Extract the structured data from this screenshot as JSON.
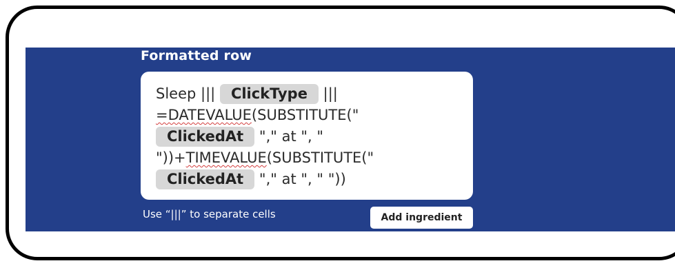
{
  "panel": {
    "title": "Formatted row",
    "helper_text": "Use “|||” to separate cells",
    "add_ingredient_label": "Add ingredient",
    "background_color": "#233f8a"
  },
  "formula": {
    "line1_prefix": "Sleep |||",
    "chip_click_type": "ClickType",
    "line1_suffix": "|||",
    "line2_text_spell": "=DATEVALUE",
    "line2_text_rest": "(SUBSTITUTE(\"",
    "chip_clicked_at_1": "ClickedAt",
    "line3_suffix": "\",\" at \", \"",
    "line4_prefix": "\"))+",
    "line4_spell": "TIMEVALUE",
    "line4_rest": "(SUBSTITUTE(\"",
    "chip_clicked_at_2": "ClickedAt",
    "line5_suffix": "\",\" at \", \" \"))"
  }
}
